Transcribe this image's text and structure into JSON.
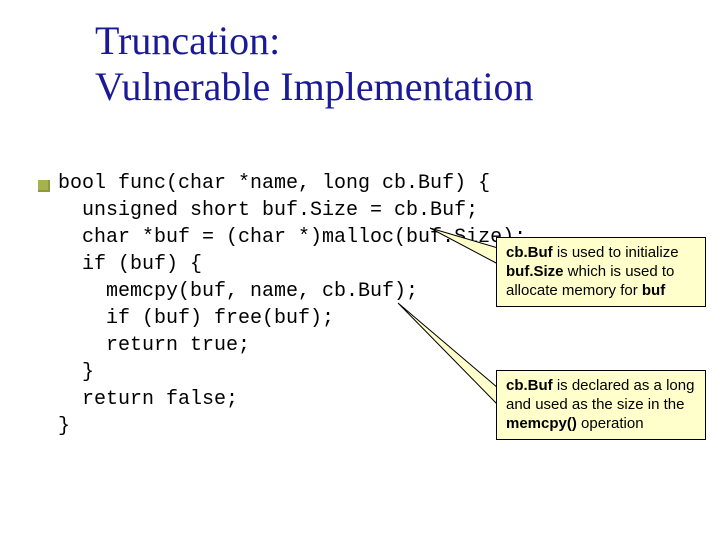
{
  "title_line1": "Truncation:",
  "title_line2": "Vulnerable Implementation",
  "code": "bool func(char *name, long cb.Buf) {\n  unsigned short buf.Size = cb.Buf;\n  char *buf = (char *)malloc(buf.Size);\n  if (buf) {\n    memcpy(buf, name, cb.Buf);\n    if (buf) free(buf);\n    return true;\n  }\n  return false;\n}",
  "callout1": {
    "m1": "cb.Buf",
    "t1": " is used to initialize ",
    "m2": "buf.Size",
    "t2": " which is used to allocate memory for ",
    "m3": "buf"
  },
  "callout2": {
    "m1": "cb.Buf",
    "t1": " is declared as a long and used as the size in the ",
    "m2": "memcpy()",
    "t2": " operation"
  }
}
